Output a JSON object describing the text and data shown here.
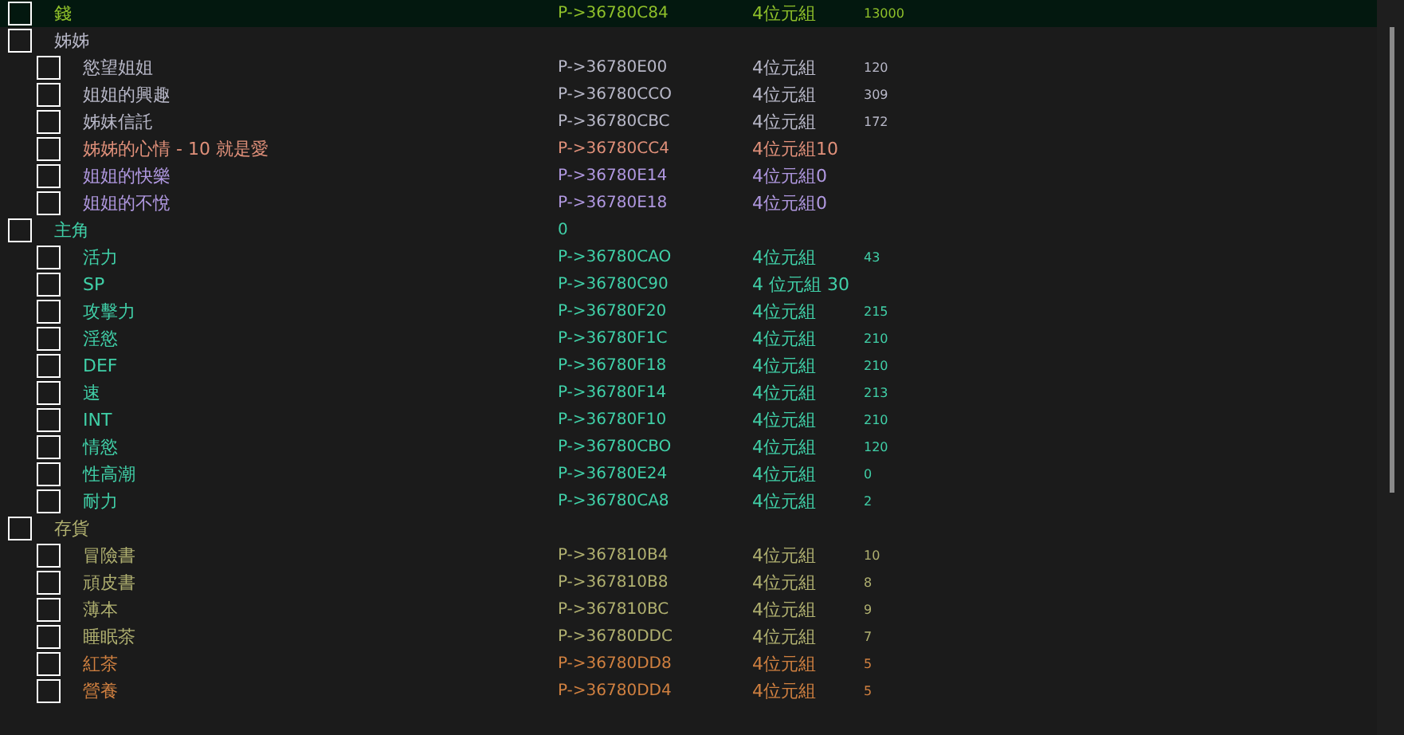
{
  "entries": [
    {
      "description": "錢",
      "address": "P->36780C84",
      "type": "4位元組",
      "value": "13000",
      "color": "#8fc02a",
      "selected": true,
      "checked": false
    },
    {
      "description": "姊姊",
      "color": "#b8b8c8",
      "selected": false,
      "checked": false,
      "children": [
        {
          "description": "慾望姐姐",
          "address": "P->36780E00",
          "type": "4位元組",
          "value": "120",
          "color": "#b8b8c8",
          "selected": false,
          "checked": false
        },
        {
          "description": "姐姐的興趣",
          "address": "P->36780CCO",
          "type": "4位元組",
          "value": "309",
          "color": "#b8b8c8",
          "selected": false,
          "checked": false
        },
        {
          "description": "姊妹信託",
          "address": "P->36780CBC",
          "type": "4位元組",
          "value": "172",
          "color": "#b8b8c8",
          "selected": false,
          "checked": false
        },
        {
          "description": "姊姊的心情 - 10 就是愛",
          "address": "P->36780CC4",
          "type": "4位元組10",
          "color": "#e0907a",
          "selected": false,
          "checked": false
        },
        {
          "description": "姐姐的快樂",
          "address": "P->36780E14",
          "type": "4位元組0",
          "color": "#b098e0",
          "selected": false,
          "checked": false
        },
        {
          "description": "姐姐的不悅",
          "address": "P->36780E18",
          "type": "4位元組0",
          "color": "#b098e0",
          "selected": false,
          "checked": false
        }
      ]
    },
    {
      "description": "主角",
      "address": "0",
      "color": "#40d0a8",
      "selected": false,
      "checked": false,
      "children": [
        {
          "description": "活力",
          "address": "P->36780CAO",
          "type": "4位元組",
          "value": "43",
          "color": "#40d0a8",
          "selected": false,
          "checked": false
        },
        {
          "description": "SP",
          "address": "P->36780C90",
          "type": "4 位元組 30",
          "color": "#40d0a8",
          "selected": false,
          "checked": false
        },
        {
          "description": "攻擊力",
          "address": "P->36780F20",
          "type": "4位元組",
          "value": "215",
          "color": "#40d0a8",
          "selected": false,
          "checked": false
        },
        {
          "description": "淫慾",
          "address": "P->36780F1C",
          "type": "4位元組",
          "value": "210",
          "color": "#40d0a8",
          "selected": false,
          "checked": false
        },
        {
          "description": "DEF",
          "address": "P->36780F18",
          "type": "4位元組",
          "value": "210",
          "color": "#40d0a8",
          "selected": false,
          "checked": false
        },
        {
          "description": "速",
          "address": "P->36780F14",
          "type": "4位元組",
          "value": "213",
          "color": "#40d0a8",
          "selected": false,
          "checked": false
        },
        {
          "description": "INT",
          "address": "P->36780F10",
          "type": "4位元組",
          "value": "210",
          "color": "#40d0a8",
          "selected": false,
          "checked": false
        },
        {
          "description": "情慾",
          "address": "P->36780CBO",
          "type": "4位元組",
          "value": "120",
          "color": "#40d0a8",
          "selected": false,
          "checked": false
        },
        {
          "description": "性高潮",
          "address": "P->36780E24",
          "type": "4位元組",
          "value": "0",
          "color": "#40d0a8",
          "selected": false,
          "checked": false
        },
        {
          "description": "耐力",
          "address": "P->36780CA8",
          "type": "4位元組",
          "value": "2",
          "color": "#40d0a8",
          "selected": false,
          "checked": false
        }
      ]
    },
    {
      "description": "存貨",
      "color": "#b0b070",
      "selected": false,
      "checked": false,
      "children": [
        {
          "description": "冒險書",
          "address": "P->367810B4",
          "type": "4位元組",
          "value": "10",
          "color": "#b0b070",
          "selected": false,
          "checked": false
        },
        {
          "description": "頑皮書",
          "address": "P->367810B8",
          "type": "4位元組",
          "value": "8",
          "color": "#b0b070",
          "selected": false,
          "checked": false
        },
        {
          "description": "薄本",
          "address": "P->367810BC",
          "type": "4位元組",
          "value": "9",
          "color": "#b0b070",
          "selected": false,
          "checked": false
        },
        {
          "description": "睡眠茶",
          "address": "P->36780DDC",
          "type": "4位元組",
          "value": "7",
          "color": "#b0b070",
          "selected": false,
          "checked": false
        },
        {
          "description": "紅茶",
          "address": "P->36780DD8",
          "type": "4位元組",
          "value": "5",
          "color": "#d08040",
          "selected": false,
          "checked": false
        },
        {
          "description": "營養",
          "address": "P->36780DD4",
          "type": "4位元組",
          "value": "5",
          "color": "#d08040",
          "selected": false,
          "checked": false
        }
      ]
    }
  ]
}
